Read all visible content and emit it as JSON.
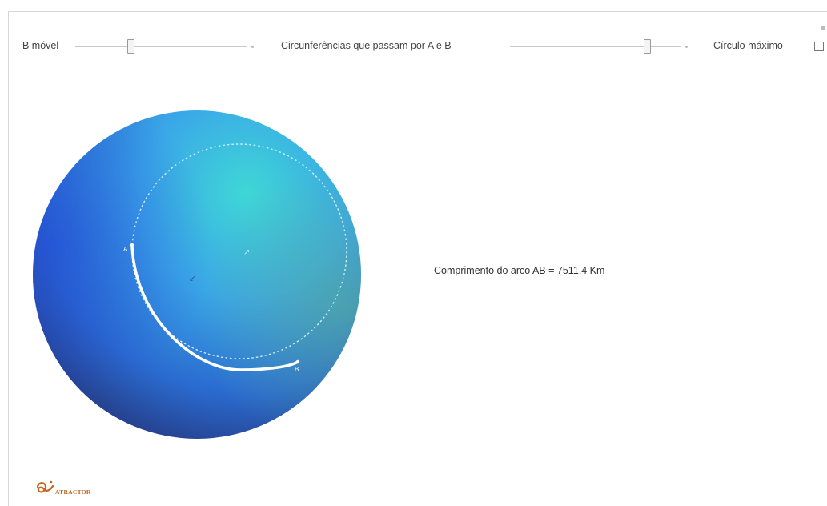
{
  "toolbar": {
    "slider_b_label": "B móvel",
    "slider_circles_label": "Circunferências que passam por A e B",
    "slider_b_value": 0.32,
    "slider_circles_value": 0.8,
    "checkbox_max_circle_label": "Círculo máximo",
    "checkbox_max_circle_checked": false
  },
  "sphere": {
    "point_a_label": "A",
    "point_b_label": "B",
    "colors": {
      "top_right": "#3fd7d6",
      "center": "#3aa6e8",
      "left": "#2462d8",
      "bottom": "#2a3f86",
      "arc": "#ffffff"
    }
  },
  "info": {
    "arc_length_text": "Comprimento do arco AB = 7511.4 Km"
  },
  "logo": {
    "text": "ATRACTOR",
    "color": "#b9611c"
  }
}
